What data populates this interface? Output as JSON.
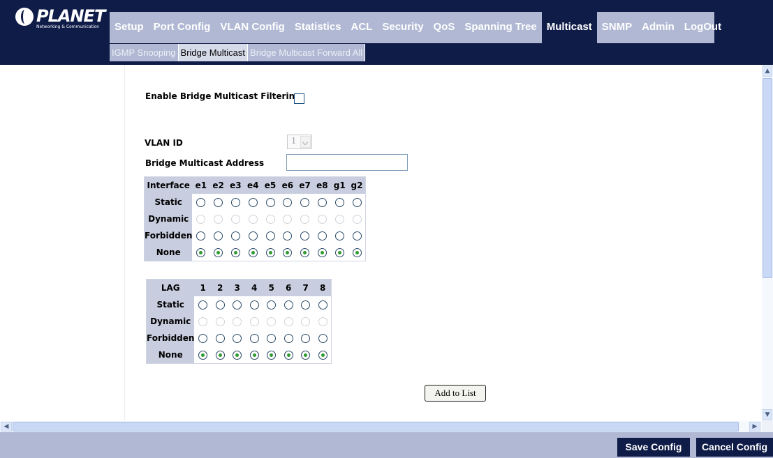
{
  "brand": {
    "name": "PLANET",
    "tagline": "Networking & Communication"
  },
  "nav": {
    "items": [
      "Setup",
      "Port Config",
      "VLAN Config",
      "Statistics",
      "ACL",
      "Security",
      "QoS",
      "Spanning Tree",
      "Multicast",
      "SNMP",
      "Admin",
      "LogOut"
    ],
    "active": "Multicast"
  },
  "subnav": {
    "items": [
      "IGMP Snooping",
      "Bridge Multicast",
      "Bridge Multicast Forward All"
    ],
    "active": "Bridge Multicast"
  },
  "form": {
    "enable_label": "Enable Bridge Multicast Filtering",
    "enable_checked": false,
    "vlan_label": "VLAN ID",
    "vlan_value": "1",
    "address_label": "Bridge Multicast Address",
    "address_value": ""
  },
  "interface_table": {
    "header": "Interface",
    "columns": [
      "e1",
      "e2",
      "e3",
      "e4",
      "e5",
      "e6",
      "e7",
      "e8",
      "g1",
      "g2"
    ],
    "rows": [
      "Static",
      "Dynamic",
      "Forbidden",
      "None"
    ],
    "selected_row": "None",
    "disabled_row": "Dynamic"
  },
  "lag_table": {
    "header": "LAG",
    "columns": [
      "1",
      "2",
      "3",
      "4",
      "5",
      "6",
      "7",
      "8"
    ],
    "rows": [
      "Static",
      "Dynamic",
      "Forbidden",
      "None"
    ],
    "selected_row": "None",
    "disabled_row": "Dynamic"
  },
  "buttons": {
    "add": "Add to List",
    "save": "Save Config",
    "cancel": "Cancel Config"
  },
  "colors": {
    "navy": "#0f1c47",
    "nav_bg": "#b0b8d3",
    "table_header": "#c8cee0",
    "radio_selected": "#2f9a2f"
  }
}
